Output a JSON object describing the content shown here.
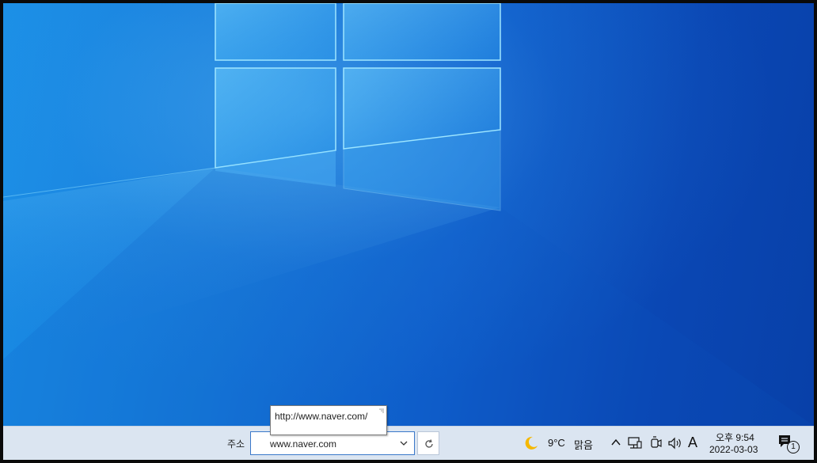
{
  "taskbar": {
    "address_label": "주소",
    "address_value": "www.naver.com",
    "tooltip_url": "http://www.naver.com/",
    "weather_temp": "9°C",
    "weather_condition": "맑음",
    "ime_mode": "A",
    "clock_time": "오후 9:54",
    "clock_date": "2022-03-03",
    "notification_count": "1"
  },
  "icons": {
    "weather": "moon-icon",
    "tray_overflow": "chevron-up-icon",
    "network": "network-icon",
    "mic": "meet-now-icon",
    "volume": "speaker-icon",
    "notifications": "action-center-icon",
    "refresh": "refresh-icon",
    "dropdown": "chevron-down-icon"
  },
  "colors": {
    "taskbar_bg": "#dbe5f1",
    "desktop_blue": "#0f5fcc",
    "address_border": "#3a78c9"
  }
}
